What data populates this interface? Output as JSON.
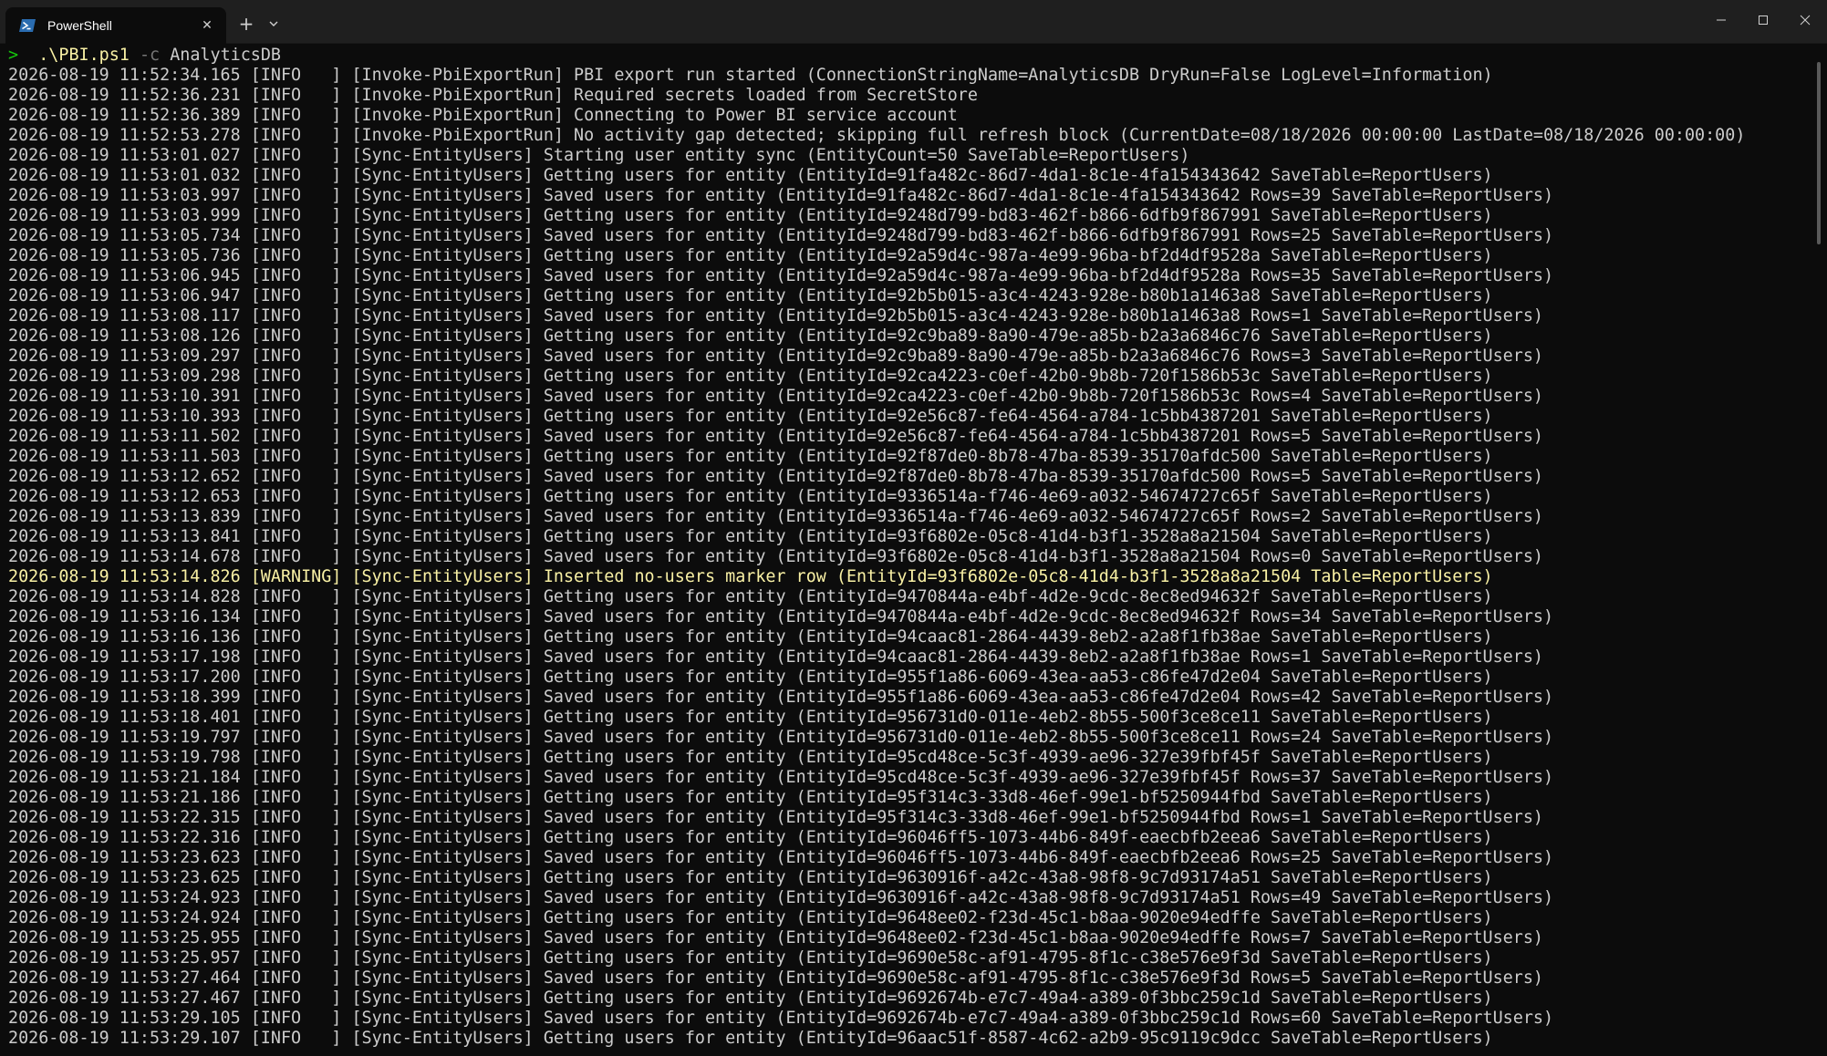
{
  "tab": {
    "title": "PowerShell",
    "icon": "powershell-icon"
  },
  "colors": {
    "background": "#0c0c0c",
    "text": "#cccccc",
    "warning": "#f9f1a5",
    "prompt_arrow": "#16c60c",
    "titlebar": "#1f1f1f"
  },
  "prompt": {
    "symbol": ">",
    "command": ".\\PBI.ps1",
    "flag": "-c",
    "argument": "AnalyticsDB"
  },
  "lines": [
    "2026-08-19 11:52:34.165 [INFO   ] [Invoke-PbiExportRun] PBI export run started (ConnectionStringName=AnalyticsDB DryRun=False LogLevel=Information)",
    "2026-08-19 11:52:36.231 [INFO   ] [Invoke-PbiExportRun] Required secrets loaded from SecretStore",
    "2026-08-19 11:52:36.389 [INFO   ] [Invoke-PbiExportRun] Connecting to Power BI service account",
    "2026-08-19 11:52:53.278 [INFO   ] [Invoke-PbiExportRun] No activity gap detected; skipping full refresh block (CurrentDate=08/18/2026 00:00:00 LastDate=08/18/2026 00:00:00)",
    "2026-08-19 11:53:01.027 [INFO   ] [Sync-EntityUsers] Starting user entity sync (EntityCount=50 SaveTable=ReportUsers)",
    "2026-08-19 11:53:01.032 [INFO   ] [Sync-EntityUsers] Getting users for entity (EntityId=91fa482c-86d7-4da1-8c1e-4fa154343642 SaveTable=ReportUsers)",
    "2026-08-19 11:53:03.997 [INFO   ] [Sync-EntityUsers] Saved users for entity (EntityId=91fa482c-86d7-4da1-8c1e-4fa154343642 Rows=39 SaveTable=ReportUsers)",
    "2026-08-19 11:53:03.999 [INFO   ] [Sync-EntityUsers] Getting users for entity (EntityId=9248d799-bd83-462f-b866-6dfb9f867991 SaveTable=ReportUsers)",
    "2026-08-19 11:53:05.734 [INFO   ] [Sync-EntityUsers] Saved users for entity (EntityId=9248d799-bd83-462f-b866-6dfb9f867991 Rows=25 SaveTable=ReportUsers)",
    "2026-08-19 11:53:05.736 [INFO   ] [Sync-EntityUsers] Getting users for entity (EntityId=92a59d4c-987a-4e99-96ba-bf2d4df9528a SaveTable=ReportUsers)",
    "2026-08-19 11:53:06.945 [INFO   ] [Sync-EntityUsers] Saved users for entity (EntityId=92a59d4c-987a-4e99-96ba-bf2d4df9528a Rows=35 SaveTable=ReportUsers)",
    "2026-08-19 11:53:06.947 [INFO   ] [Sync-EntityUsers] Getting users for entity (EntityId=92b5b015-a3c4-4243-928e-b80b1a1463a8 SaveTable=ReportUsers)",
    "2026-08-19 11:53:08.117 [INFO   ] [Sync-EntityUsers] Saved users for entity (EntityId=92b5b015-a3c4-4243-928e-b80b1a1463a8 Rows=1 SaveTable=ReportUsers)",
    "2026-08-19 11:53:08.126 [INFO   ] [Sync-EntityUsers] Getting users for entity (EntityId=92c9ba89-8a90-479e-a85b-b2a3a6846c76 SaveTable=ReportUsers)",
    "2026-08-19 11:53:09.297 [INFO   ] [Sync-EntityUsers] Saved users for entity (EntityId=92c9ba89-8a90-479e-a85b-b2a3a6846c76 Rows=3 SaveTable=ReportUsers)",
    "2026-08-19 11:53:09.298 [INFO   ] [Sync-EntityUsers] Getting users for entity (EntityId=92ca4223-c0ef-42b0-9b8b-720f1586b53c SaveTable=ReportUsers)",
    "2026-08-19 11:53:10.391 [INFO   ] [Sync-EntityUsers] Saved users for entity (EntityId=92ca4223-c0ef-42b0-9b8b-720f1586b53c Rows=4 SaveTable=ReportUsers)",
    "2026-08-19 11:53:10.393 [INFO   ] [Sync-EntityUsers] Getting users for entity (EntityId=92e56c87-fe64-4564-a784-1c5bb4387201 SaveTable=ReportUsers)",
    "2026-08-19 11:53:11.502 [INFO   ] [Sync-EntityUsers] Saved users for entity (EntityId=92e56c87-fe64-4564-a784-1c5bb4387201 Rows=5 SaveTable=ReportUsers)",
    "2026-08-19 11:53:11.503 [INFO   ] [Sync-EntityUsers] Getting users for entity (EntityId=92f87de0-8b78-47ba-8539-35170afdc500 SaveTable=ReportUsers)",
    "2026-08-19 11:53:12.652 [INFO   ] [Sync-EntityUsers] Saved users for entity (EntityId=92f87de0-8b78-47ba-8539-35170afdc500 Rows=5 SaveTable=ReportUsers)",
    "2026-08-19 11:53:12.653 [INFO   ] [Sync-EntityUsers] Getting users for entity (EntityId=9336514a-f746-4e69-a032-54674727c65f SaveTable=ReportUsers)",
    "2026-08-19 11:53:13.839 [INFO   ] [Sync-EntityUsers] Saved users for entity (EntityId=9336514a-f746-4e69-a032-54674727c65f Rows=2 SaveTable=ReportUsers)",
    "2026-08-19 11:53:13.841 [INFO   ] [Sync-EntityUsers] Getting users for entity (EntityId=93f6802e-05c8-41d4-b3f1-3528a8a21504 SaveTable=ReportUsers)",
    "2026-08-19 11:53:14.678 [INFO   ] [Sync-EntityUsers] Saved users for entity (EntityId=93f6802e-05c8-41d4-b3f1-3528a8a21504 Rows=0 SaveTable=ReportUsers)",
    "2026-08-19 11:53:14.826 [WARNING] [Sync-EntityUsers] Inserted no-users marker row (EntityId=93f6802e-05c8-41d4-b3f1-3528a8a21504 Table=ReportUsers)",
    "2026-08-19 11:53:14.828 [INFO   ] [Sync-EntityUsers] Getting users for entity (EntityId=9470844a-e4bf-4d2e-9cdc-8ec8ed94632f SaveTable=ReportUsers)",
    "2026-08-19 11:53:16.134 [INFO   ] [Sync-EntityUsers] Saved users for entity (EntityId=9470844a-e4bf-4d2e-9cdc-8ec8ed94632f Rows=34 SaveTable=ReportUsers)",
    "2026-08-19 11:53:16.136 [INFO   ] [Sync-EntityUsers] Getting users for entity (EntityId=94caac81-2864-4439-8eb2-a2a8f1fb38ae SaveTable=ReportUsers)",
    "2026-08-19 11:53:17.198 [INFO   ] [Sync-EntityUsers] Saved users for entity (EntityId=94caac81-2864-4439-8eb2-a2a8f1fb38ae Rows=1 SaveTable=ReportUsers)",
    "2026-08-19 11:53:17.200 [INFO   ] [Sync-EntityUsers] Getting users for entity (EntityId=955f1a86-6069-43ea-aa53-c86fe47d2e04 SaveTable=ReportUsers)",
    "2026-08-19 11:53:18.399 [INFO   ] [Sync-EntityUsers] Saved users for entity (EntityId=955f1a86-6069-43ea-aa53-c86fe47d2e04 Rows=42 SaveTable=ReportUsers)",
    "2026-08-19 11:53:18.401 [INFO   ] [Sync-EntityUsers] Getting users for entity (EntityId=956731d0-011e-4eb2-8b55-500f3ce8ce11 SaveTable=ReportUsers)",
    "2026-08-19 11:53:19.797 [INFO   ] [Sync-EntityUsers] Saved users for entity (EntityId=956731d0-011e-4eb2-8b55-500f3ce8ce11 Rows=24 SaveTable=ReportUsers)",
    "2026-08-19 11:53:19.798 [INFO   ] [Sync-EntityUsers] Getting users for entity (EntityId=95cd48ce-5c3f-4939-ae96-327e39fbf45f SaveTable=ReportUsers)",
    "2026-08-19 11:53:21.184 [INFO   ] [Sync-EntityUsers] Saved users for entity (EntityId=95cd48ce-5c3f-4939-ae96-327e39fbf45f Rows=37 SaveTable=ReportUsers)",
    "2026-08-19 11:53:21.186 [INFO   ] [Sync-EntityUsers] Getting users for entity (EntityId=95f314c3-33d8-46ef-99e1-bf5250944fbd SaveTable=ReportUsers)",
    "2026-08-19 11:53:22.315 [INFO   ] [Sync-EntityUsers] Saved users for entity (EntityId=95f314c3-33d8-46ef-99e1-bf5250944fbd Rows=1 SaveTable=ReportUsers)",
    "2026-08-19 11:53:22.316 [INFO   ] [Sync-EntityUsers] Getting users for entity (EntityId=96046ff5-1073-44b6-849f-eaecbfb2eea6 SaveTable=ReportUsers)",
    "2026-08-19 11:53:23.623 [INFO   ] [Sync-EntityUsers] Saved users for entity (EntityId=96046ff5-1073-44b6-849f-eaecbfb2eea6 Rows=25 SaveTable=ReportUsers)",
    "2026-08-19 11:53:23.625 [INFO   ] [Sync-EntityUsers] Getting users for entity (EntityId=9630916f-a42c-43a8-98f8-9c7d93174a51 SaveTable=ReportUsers)",
    "2026-08-19 11:53:24.923 [INFO   ] [Sync-EntityUsers] Saved users for entity (EntityId=9630916f-a42c-43a8-98f8-9c7d93174a51 Rows=49 SaveTable=ReportUsers)",
    "2026-08-19 11:53:24.924 [INFO   ] [Sync-EntityUsers] Getting users for entity (EntityId=9648ee02-f23d-45c1-b8aa-9020e94edffe SaveTable=ReportUsers)",
    "2026-08-19 11:53:25.955 [INFO   ] [Sync-EntityUsers] Saved users for entity (EntityId=9648ee02-f23d-45c1-b8aa-9020e94edffe Rows=7 SaveTable=ReportUsers)",
    "2026-08-19 11:53:25.957 [INFO   ] [Sync-EntityUsers] Getting users for entity (EntityId=9690e58c-af91-4795-8f1c-c38e576e9f3d SaveTable=ReportUsers)",
    "2026-08-19 11:53:27.464 [INFO   ] [Sync-EntityUsers] Saved users for entity (EntityId=9690e58c-af91-4795-8f1c-c38e576e9f3d Rows=5 SaveTable=ReportUsers)",
    "2026-08-19 11:53:27.467 [INFO   ] [Sync-EntityUsers] Getting users for entity (EntityId=9692674b-e7c7-49a4-a389-0f3bbc259c1d SaveTable=ReportUsers)",
    "2026-08-19 11:53:29.105 [INFO   ] [Sync-EntityUsers] Saved users for entity (EntityId=9692674b-e7c7-49a4-a389-0f3bbc259c1d Rows=60 SaveTable=ReportUsers)",
    "2026-08-19 11:53:29.107 [INFO   ] [Sync-EntityUsers] Getting users for entity (EntityId=96aac51f-8587-4c62-a2b9-95c9119c9dcc SaveTable=ReportUsers)"
  ],
  "warning_line_indices": [
    25
  ]
}
